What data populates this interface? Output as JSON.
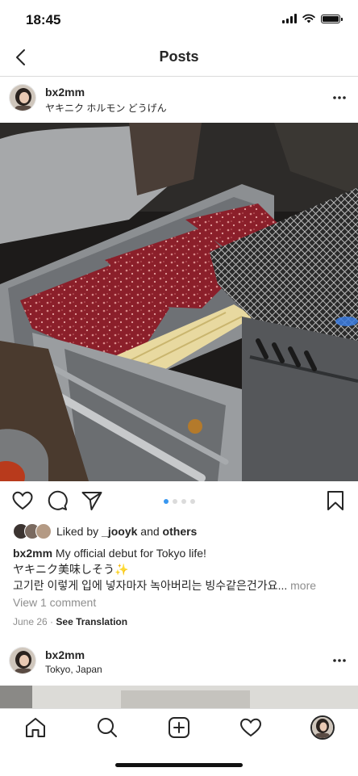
{
  "status_bar": {
    "time": "18:45"
  },
  "nav": {
    "title": "Posts"
  },
  "post": {
    "username": "bx2mm",
    "location": "ヤキニク ホルモン どうげん",
    "carousel": {
      "count": 4,
      "active_index": 0
    },
    "likes": {
      "prefix": "Liked by",
      "user": "_jooyk",
      "joiner": "and",
      "others": "others"
    },
    "caption": {
      "username": "bx2mm",
      "line1": "My official debut for Tokyo life!",
      "line2": "ヤキニク美味しそう✨",
      "line3": "고기란 이렇게 입에 넣자마자 녹아버리는 빙수같은건가요...",
      "more": "more"
    },
    "view_comments": "View 1 comment",
    "date": "June 26",
    "separator": "·",
    "see_translation": "See Translation"
  },
  "next_post": {
    "username": "bx2mm",
    "location": "Tokyo, Japan"
  },
  "colors": {
    "accent": "#3897f0",
    "text": "#262626",
    "muted": "#8e8e8e",
    "divider": "#dbdbdb"
  },
  "icons": {
    "nav": "chevron-left-icon",
    "post_actions": [
      "heart-icon",
      "comment-icon",
      "share-icon",
      "bookmark-icon"
    ],
    "tab_bar": [
      "home-icon",
      "search-icon",
      "add-post-icon",
      "activity-heart-icon",
      "profile-avatar"
    ]
  }
}
